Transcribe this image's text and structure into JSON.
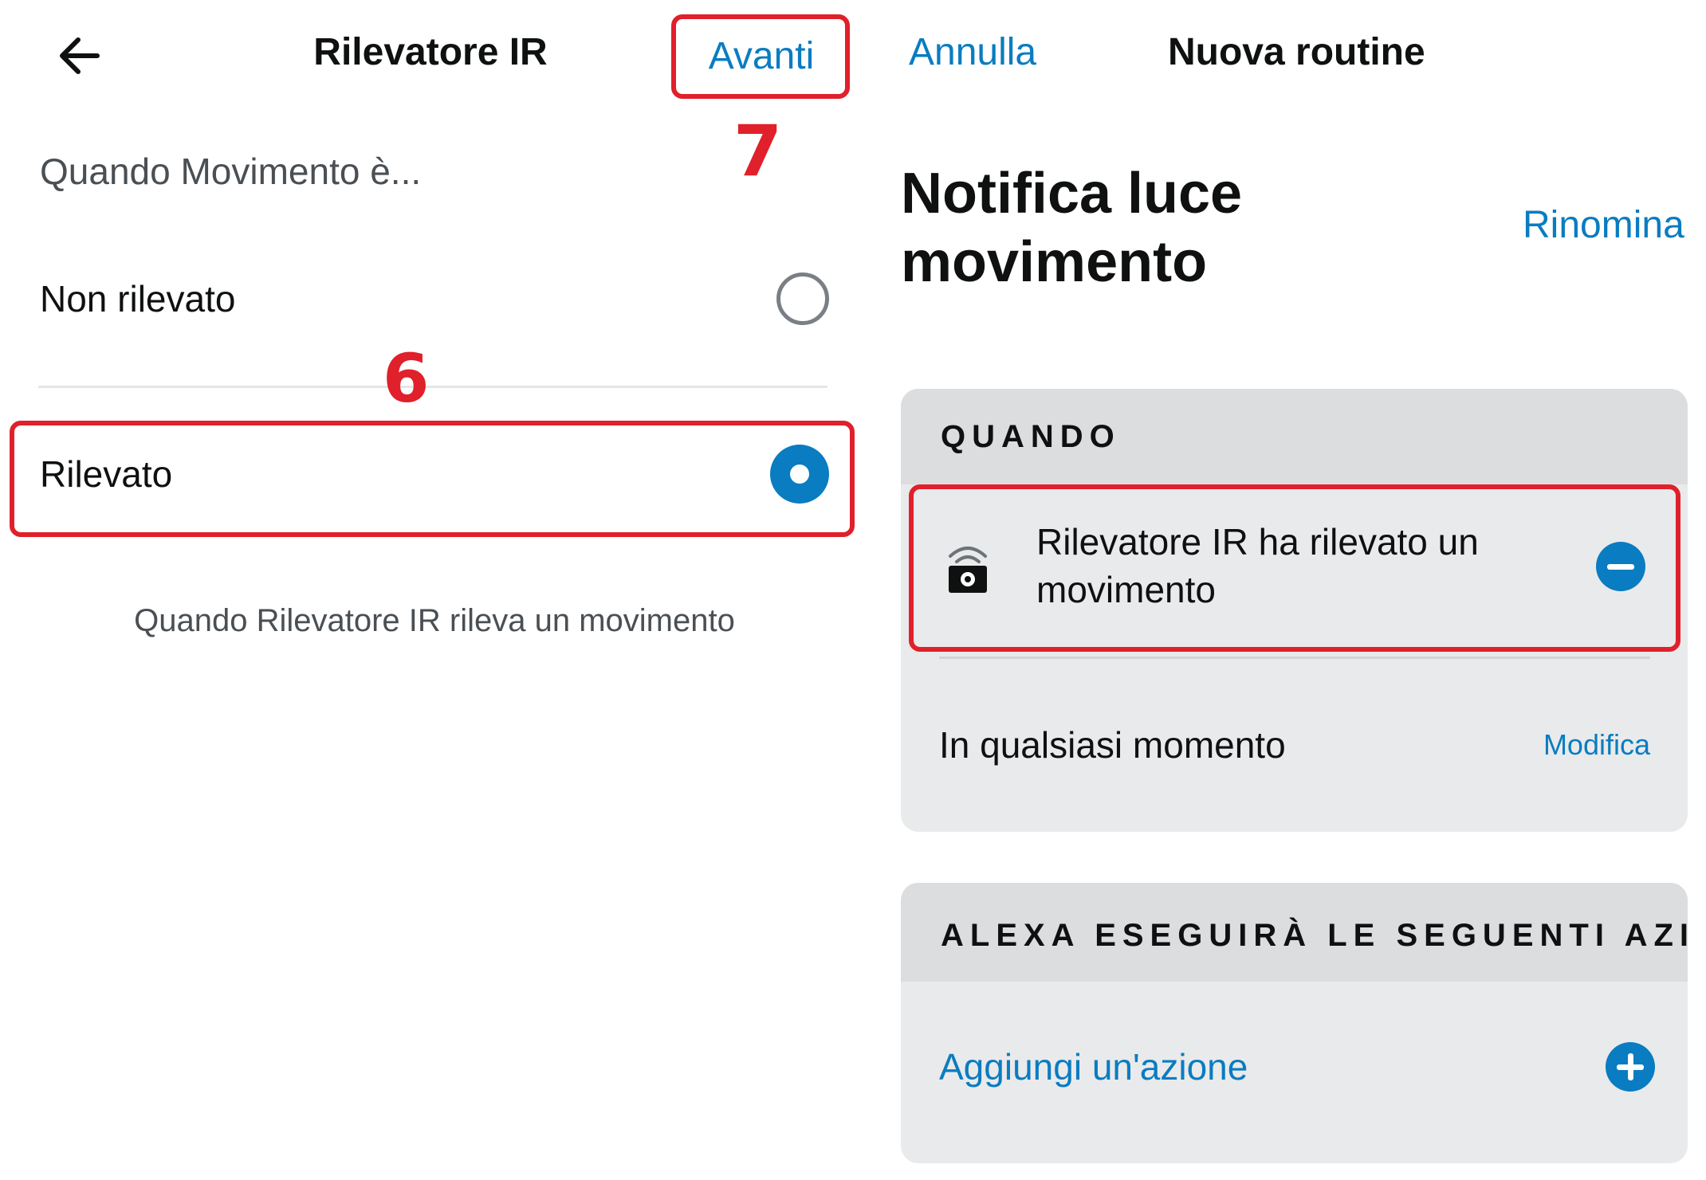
{
  "left_screen": {
    "back_icon": "arrow-left-icon",
    "title": "Rilevatore IR",
    "next_label": "Avanti",
    "prompt": "Quando Movimento è...",
    "options": [
      {
        "label": "Non rilevato",
        "selected": false
      },
      {
        "label": "Rilevato",
        "selected": true
      }
    ],
    "description": "Quando Rilevatore IR rileva un movimento"
  },
  "right_screen": {
    "cancel_label": "Annulla",
    "title": "Nuova routine",
    "routine_name": "Notifica luce movimento",
    "rename_label": "Rinomina",
    "when_card": {
      "header": "QUANDO",
      "trigger_icon": "ir-sensor-icon",
      "trigger_text": "Rilevatore IR ha rilevato un movimento",
      "remove_icon": "minus-circle-icon",
      "time_label": "In qualsiasi momento",
      "edit_label": "Modifica"
    },
    "actions_card": {
      "header": "ALEXA ESEGUIRÀ LE SEGUENTI AZI...",
      "add_label": "Aggiungi un'azione",
      "add_icon": "plus-circle-icon"
    }
  },
  "annotations": {
    "step_6": "6",
    "step_7": "7"
  },
  "colors": {
    "accent": "#0a7cc1",
    "highlight": "#e0202a",
    "card_bg": "#e9eaeb",
    "card_header_bg": "#dcdddf"
  }
}
